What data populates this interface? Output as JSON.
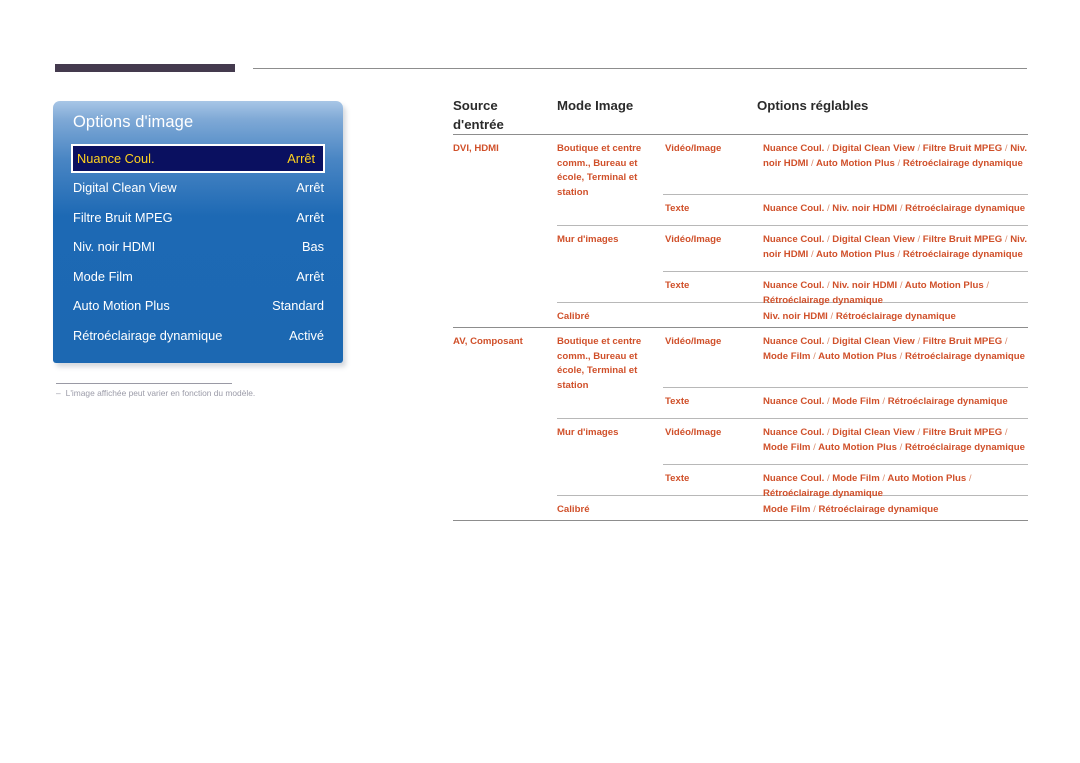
{
  "colors": {
    "accent_orange": "#d0502a",
    "separator_orange": "#dd8e70",
    "osd_blue": "#1c68b2",
    "osd_highlight_bg": "#0a1060",
    "osd_highlight_text": "#ffd21e",
    "top_rule_dark": "#443a4e",
    "header_text": "#2b2b2b",
    "footnote_text": "#9b9ba8"
  },
  "osd": {
    "title": "Options d'image",
    "items": [
      {
        "label": "Nuance Coul.",
        "value": "Arrêt",
        "selected": true
      },
      {
        "label": "Digital Clean View",
        "value": "Arrêt",
        "selected": false
      },
      {
        "label": "Filtre Bruit MPEG",
        "value": "Arrêt",
        "selected": false
      },
      {
        "label": "Niv. noir HDMI",
        "value": "Bas",
        "selected": false
      },
      {
        "label": "Mode Film",
        "value": "Arrêt",
        "selected": false
      },
      {
        "label": "Auto Motion Plus",
        "value": "Standard",
        "selected": false
      },
      {
        "label": "Rétroéclairage dynamique",
        "value": "Activé",
        "selected": false
      }
    ]
  },
  "footnote": {
    "dash": "‒",
    "text": "L'image affichée peut varier en fonction du modèle."
  },
  "table": {
    "headers": {
      "col1": "Source d'entrée",
      "col2": "Mode Image",
      "col3": "",
      "col4": "Options réglables"
    },
    "rows": [
      {
        "source": "DVI, HDMI",
        "mode": "Boutique et centre comm., Bureau et école, Terminal et station",
        "sub": "Vidéo/Image",
        "options": "Nuance Coul. / Digital Clean View / Filtre Bruit MPEG / Niv. noir HDMI / Auto Motion Plus / Rétroéclairage dynamique"
      },
      {
        "source": "",
        "mode": "",
        "sub": "Texte",
        "options": "Nuance Coul. / Niv. noir HDMI / Rétroéclairage dynamique"
      },
      {
        "source": "",
        "mode": "Mur d'images",
        "sub": "Vidéo/Image",
        "options": "Nuance Coul. / Digital Clean View / Filtre Bruit MPEG / Niv. noir HDMI / Auto Motion Plus / Rétroéclairage dynamique"
      },
      {
        "source": "",
        "mode": "",
        "sub": "Texte",
        "options": "Nuance Coul. / Niv. noir HDMI / Auto Motion Plus / Rétroéclairage dynamique"
      },
      {
        "source": "",
        "mode": "Calibré",
        "sub": "",
        "options": "Niv. noir HDMI / Rétroéclairage dynamique"
      },
      {
        "source": "AV, Composant",
        "mode": "Boutique et centre comm., Bureau et école, Terminal et station",
        "sub": "Vidéo/Image",
        "options": "Nuance Coul. / Digital Clean View / Filtre Bruit MPEG / Mode Film / Auto Motion Plus / Rétroéclairage dynamique"
      },
      {
        "source": "",
        "mode": "",
        "sub": "Texte",
        "options": "Nuance Coul. / Mode Film / Rétroéclairage dynamique"
      },
      {
        "source": "",
        "mode": "Mur d'images",
        "sub": "Vidéo/Image",
        "options": "Nuance Coul. / Digital Clean View / Filtre Bruit MPEG / Mode Film / Auto Motion Plus / Rétroéclairage dynamique"
      },
      {
        "source": "",
        "mode": "",
        "sub": "Texte",
        "options": "Nuance Coul. / Mode Film / Auto Motion Plus / Rétroéclairage dynamique"
      },
      {
        "source": "",
        "mode": "Calibré",
        "sub": "",
        "options": "Mode Film / Rétroéclairage dynamique"
      }
    ]
  }
}
